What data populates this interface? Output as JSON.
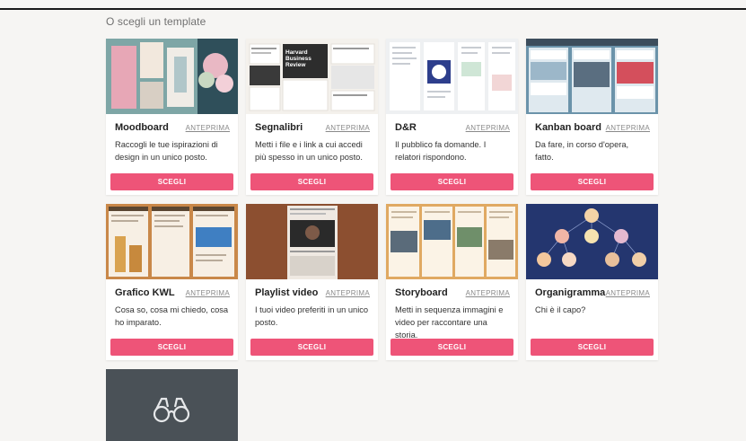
{
  "section_title": "O scegli un template",
  "preview_label": "ANTEPRIMA",
  "choose_label": "SCEGLI",
  "templates": [
    {
      "title": "Moodboard",
      "description": "Raccogli le tue ispirazioni di design in un unico posto."
    },
    {
      "title": "Segnalibri",
      "description": "Metti i file e i link a cui accedi più spesso in un unico posto."
    },
    {
      "title": "D&R",
      "description": "Il pubblico fa domande. I relatori rispondono."
    },
    {
      "title": "Kanban board",
      "description": "Da fare, in corso d'opera, fatto."
    },
    {
      "title": "Grafico KWL",
      "description": "Cosa so, cosa mi chiedo, cosa ho imparato."
    },
    {
      "title": "Playlist video",
      "description": "I tuoi video preferiti in un unico posto."
    },
    {
      "title": "Storyboard",
      "description": "Metti in sequenza immagini e video per raccontare una storia."
    },
    {
      "title": "Organigramma",
      "description": "Chi è il capo?"
    }
  ],
  "thumb_texts": {
    "segnalibri_book": "Harvard Business Review"
  },
  "icons": {
    "blank_card": "binoculars-icon"
  },
  "colors": {
    "accent": "#ee5478",
    "blank_card_bg": "#4a5157"
  }
}
